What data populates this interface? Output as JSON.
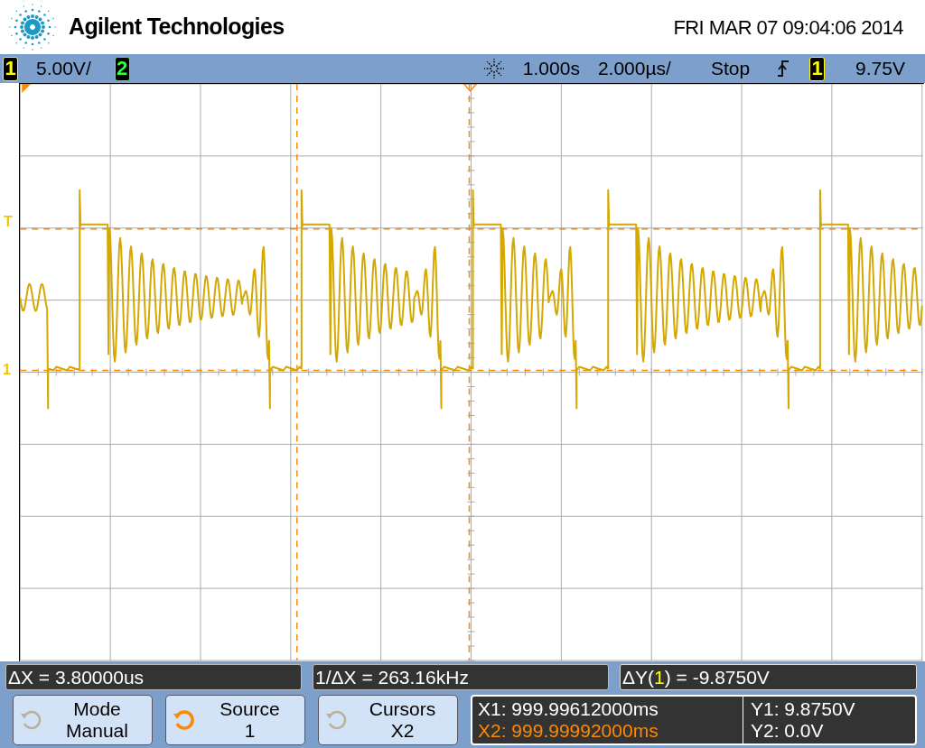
{
  "brand": "Agilent Technologies",
  "datetime": "FRI MAR 07 09:04:06 2014",
  "status_bar": {
    "channels": [
      {
        "number": "1",
        "color": "#ffff00",
        "scale": "5.00V/"
      },
      {
        "number": "2",
        "color": "#33ff33"
      }
    ],
    "delay": "1.000s",
    "timebase": "2.000µs/",
    "run_state": "Stop",
    "trigger_source": "1",
    "trigger_level": "9.75V"
  },
  "graticule": {
    "trigger_marker": "T",
    "ground_marker": "1"
  },
  "readouts": {
    "delta_x": "ΔX = 3.80000us",
    "inverse_delta_x": "1/ΔX = 263.16kHz",
    "delta_y": {
      "prefix": "ΔY(",
      "channel": "1",
      "suffix": " ) = -9.8750V"
    }
  },
  "softkeys": [
    {
      "label": "Mode",
      "value": "Manual",
      "active": false
    },
    {
      "label": "Source",
      "value": "1",
      "active": true
    },
    {
      "label": "Cursors",
      "value": "X2",
      "active": false
    }
  ],
  "cursor_values": [
    {
      "label": "X1: 999.99612000ms",
      "selected": false
    },
    {
      "label": "X2: 999.99992000ms",
      "selected": true
    }
  ],
  "y_values": [
    "Y1: 9.8750V",
    "Y2: 0.0V"
  ]
}
